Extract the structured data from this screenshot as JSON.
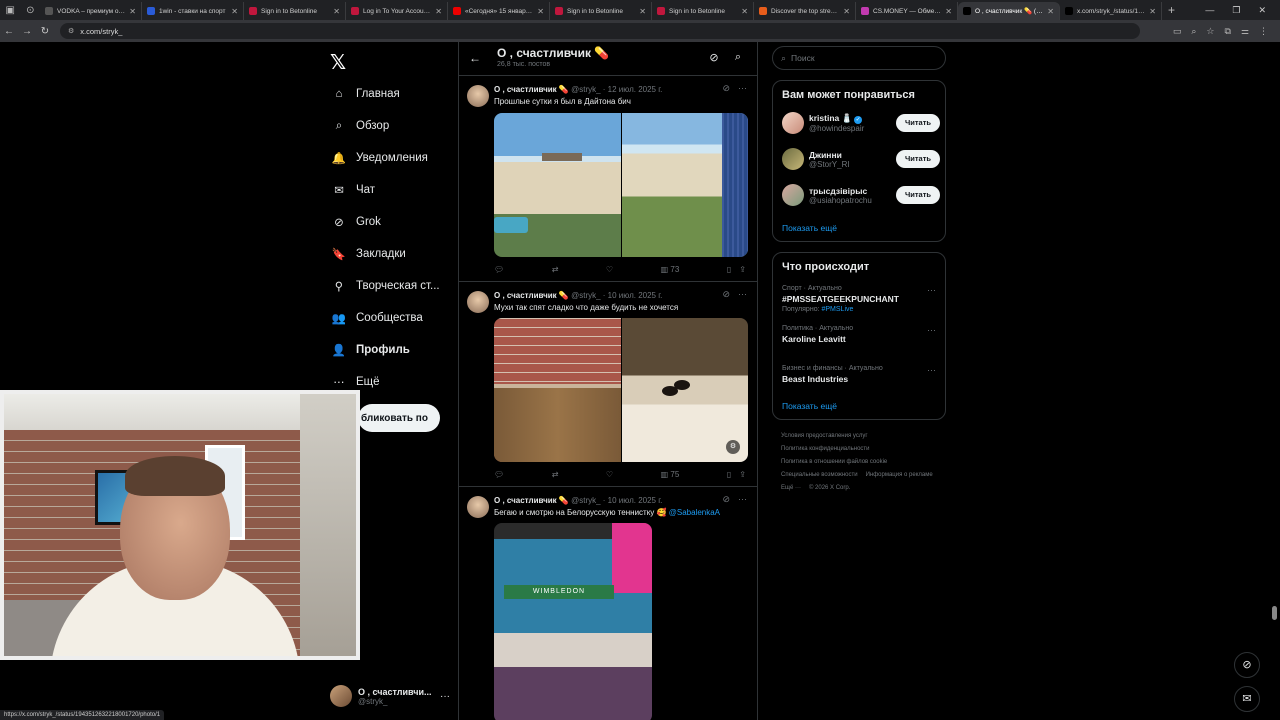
{
  "browser": {
    "tabs": [
      {
        "title": "VODKA – премиум онл...",
        "color": "#555"
      },
      {
        "title": "1win - ставки на спорт",
        "color": "#2a5bd7"
      },
      {
        "title": "Sign in to Betonline",
        "color": "#c0173d"
      },
      {
        "title": "Log in To Your Account |",
        "color": "#c0173d"
      },
      {
        "title": "«Сегодня» 15 января 20...",
        "color": "#e00"
      },
      {
        "title": "Sign in to Betonline",
        "color": "#c0173d"
      },
      {
        "title": "Sign in to Betonline",
        "color": "#c0173d"
      },
      {
        "title": "Discover the top stream...",
        "color": "#e85d1b"
      },
      {
        "title": "CS.MONEY — Обмен ск...",
        "color": "#c23ab0"
      },
      {
        "title": "О , счастливчик 💊 (@...",
        "color": "#000"
      },
      {
        "title": "x.com/stryk_/status/195...",
        "color": "#000"
      }
    ],
    "url": "x.com/stryk_",
    "status_url": "https://x.com/stryk_/status/1943512632218001720/photo/1"
  },
  "nav": {
    "logo": "𝕏",
    "items": [
      {
        "label": "Главная",
        "icon": "home-icon",
        "glyph": "⌂"
      },
      {
        "label": "Обзор",
        "icon": "search-icon",
        "glyph": "⌕"
      },
      {
        "label": "Уведомления",
        "icon": "bell-icon",
        "glyph": "🔔"
      },
      {
        "label": "Чат",
        "icon": "mail-icon",
        "glyph": "✉"
      },
      {
        "label": "Grok",
        "icon": "grok-icon",
        "glyph": "⊘"
      },
      {
        "label": "Закладки",
        "icon": "bookmark-icon",
        "glyph": "🔖"
      },
      {
        "label": "Творческая ст...",
        "icon": "creator-studio-icon",
        "glyph": "⚲"
      },
      {
        "label": "Сообщества",
        "icon": "communities-icon",
        "glyph": "👥"
      },
      {
        "label": "Профиль",
        "icon": "profile-icon",
        "glyph": "👤"
      },
      {
        "label": "Ещё",
        "icon": "more-icon",
        "glyph": "⋯"
      }
    ],
    "post_button": "бликовать по",
    "account": {
      "name": "О , счастливчи...",
      "handle": "@stryk_"
    }
  },
  "profile_header": {
    "name": "О , счастливчик 💊",
    "posts_count": "26,8 тыс. постов"
  },
  "tweets": [
    {
      "name": "О , счастливчик 💊",
      "handle": "@stryk_",
      "date": "· 12 июл. 2025 г.",
      "text": "Прошлые  сутки я был  в Дайтона бич",
      "views": "73"
    },
    {
      "name": "О , счастливчик 💊",
      "handle": "@stryk_",
      "date": "· 10 июл. 2025 г.",
      "text": "Мухи так спят сладко что даже будить не хочется",
      "views": "75"
    },
    {
      "name": "О , счастливчик 💊",
      "handle": "@stryk_",
      "date": "· 10 июл. 2025 г.",
      "text": "Бегаю и смотрю на Белорусскую  теннистку 🥰",
      "mention": "@SabalenkaA",
      "tv_banner": "WIMBLEDON"
    }
  ],
  "search": {
    "placeholder": "Поиск"
  },
  "who_to_follow": {
    "title": "Вам может понравиться",
    "follow_label": "Читать",
    "users": [
      {
        "name": "kristina 🧂",
        "handle": "@howindespair",
        "verified": true
      },
      {
        "name": "Джинни",
        "handle": "@StorY_RI",
        "verified": false
      },
      {
        "name": "трысдзівірыс",
        "handle": "@usiahopatrochu",
        "verified": false
      }
    ],
    "show_more": "Показать ещё"
  },
  "trends": {
    "title": "Что происходит",
    "items": [
      {
        "category": "Спорт · Актуально",
        "name": "#PMSSEATGEEKPUNCHANT",
        "sub": "Популярно: ",
        "sub_link": "#PMSLive"
      },
      {
        "category": "Политика · Актуально",
        "name": "Karoline Leavitt",
        "sub": "",
        "sub_link": ""
      },
      {
        "category": "Бизнес и финансы · Актуально",
        "name": "Beast Industries",
        "sub": "",
        "sub_link": ""
      }
    ],
    "show_more": "Показать ещё"
  },
  "footer": {
    "links": [
      "Условия предоставления услуг",
      "Политика конфиденциальности",
      "Политика в отношении файлов cookie",
      "Специальные возможности",
      "Информация о рекламе",
      "Ещё ···",
      "© 2026 X Corp."
    ]
  },
  "colors": {
    "accent": "#1d9bf0",
    "background": "#000000",
    "border": "#2f3336"
  }
}
